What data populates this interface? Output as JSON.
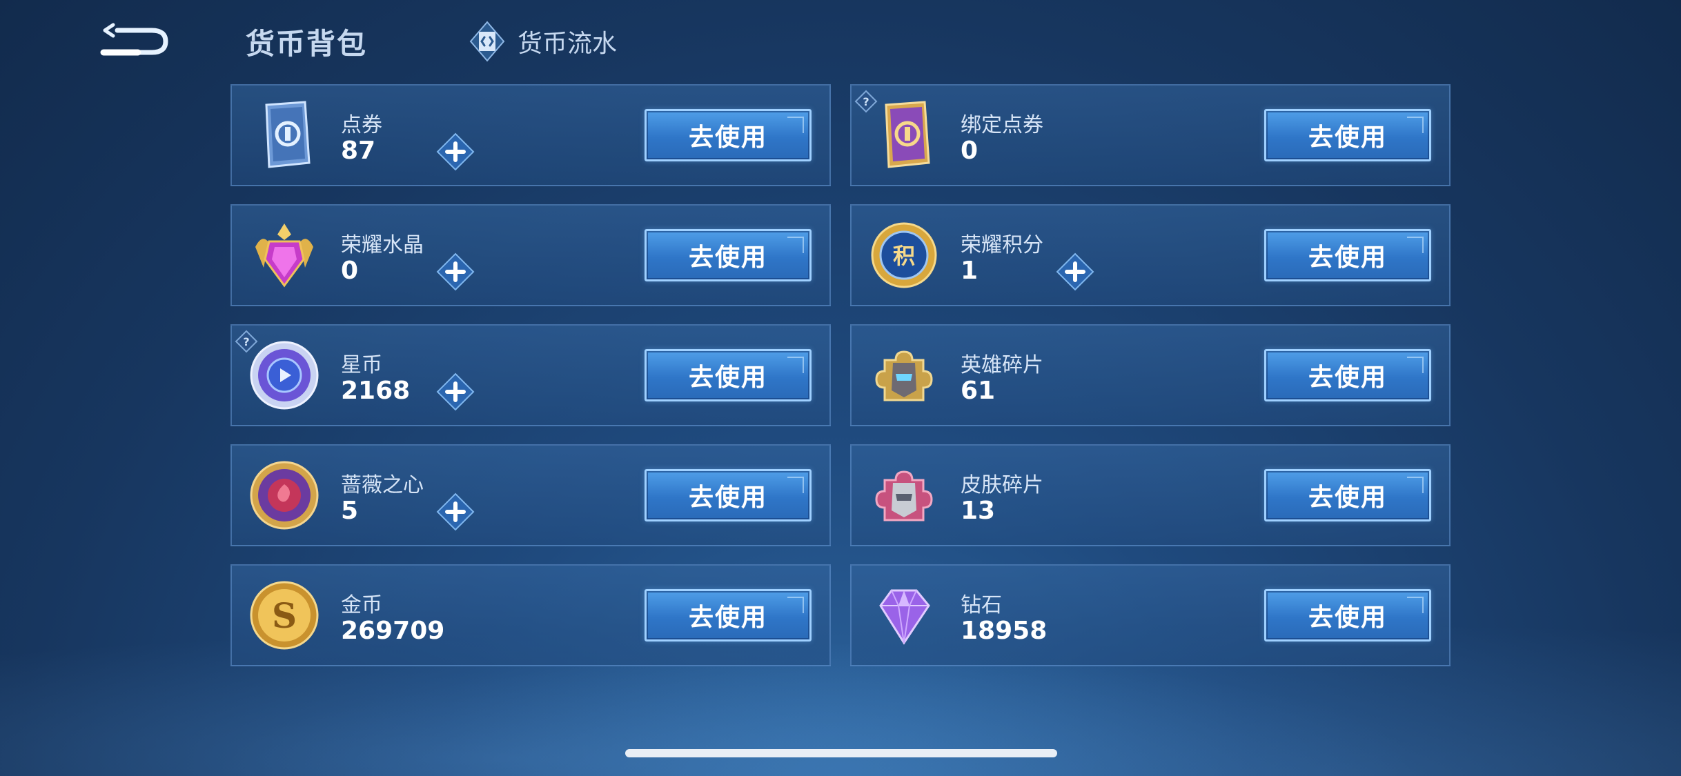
{
  "header": {
    "title": "货币背包",
    "flow_tab_label": "货币流水"
  },
  "items": [
    {
      "name": "点券",
      "count": "87",
      "icon": "coupon-card-icon",
      "has_plus": true,
      "has_help": false,
      "button": "去使用"
    },
    {
      "name": "绑定点券",
      "count": "0",
      "icon": "bound-coupon-card-icon",
      "has_plus": false,
      "has_help": true,
      "button": "去使用"
    },
    {
      "name": "荣耀水晶",
      "count": "0",
      "icon": "glory-crystal-icon",
      "has_plus": true,
      "has_help": false,
      "button": "去使用"
    },
    {
      "name": "荣耀积分",
      "count": "1",
      "icon": "glory-points-icon",
      "has_plus": true,
      "has_help": false,
      "button": "去使用"
    },
    {
      "name": "星币",
      "count": "2168",
      "icon": "star-coin-icon",
      "has_plus": true,
      "has_help": true,
      "button": "去使用"
    },
    {
      "name": "英雄碎片",
      "count": "61",
      "icon": "hero-fragment-icon",
      "has_plus": false,
      "has_help": false,
      "button": "去使用"
    },
    {
      "name": "蔷薇之心",
      "count": "5",
      "icon": "rose-heart-icon",
      "has_plus": true,
      "has_help": false,
      "button": "去使用"
    },
    {
      "name": "皮肤碎片",
      "count": "13",
      "icon": "skin-fragment-icon",
      "has_plus": false,
      "has_help": false,
      "button": "去使用"
    },
    {
      "name": "金币",
      "count": "269709",
      "icon": "gold-coin-icon",
      "has_plus": false,
      "has_help": false,
      "button": "去使用"
    },
    {
      "name": "钻石",
      "count": "18958",
      "icon": "diamond-icon",
      "has_plus": false,
      "has_help": false,
      "button": "去使用"
    }
  ],
  "colors": {
    "accent": "#4f9ee8",
    "card_border": "#6ea0dc",
    "background": "#1f4a7e"
  }
}
